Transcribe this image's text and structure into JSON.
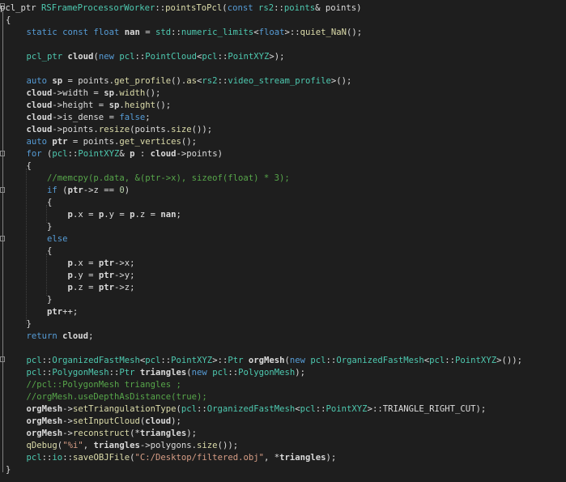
{
  "editor": {
    "theme_colors": {
      "background": "#1e1e1e",
      "plain": "#dcdcdc",
      "keyword": "#569cd6",
      "type": "#4ec9b0",
      "function": "#dcdcaa",
      "variable": "#dadada",
      "comment": "#57a64a",
      "string": "#d69d85",
      "number": "#b5cea8"
    },
    "lines": [
      [
        [
          "plain",
          "pcl_ptr "
        ],
        [
          "type",
          "RSFrameProcessorWorker"
        ],
        [
          "plain",
          "::"
        ],
        [
          "func",
          "pointsToPcl"
        ],
        [
          "plain",
          "("
        ],
        [
          "kw",
          "const "
        ],
        [
          "type",
          "rs2"
        ],
        [
          "plain",
          "::"
        ],
        [
          "type",
          "points"
        ],
        [
          "plain",
          "& points)"
        ]
      ],
      [
        [
          "plain",
          "{"
        ]
      ],
      [
        [
          "plain",
          "    "
        ],
        [
          "kw",
          "static const float "
        ],
        [
          "var",
          "nan"
        ],
        [
          "plain",
          " = "
        ],
        [
          "type",
          "std"
        ],
        [
          "plain",
          "::"
        ],
        [
          "type",
          "numeric_limits"
        ],
        [
          "plain",
          "<"
        ],
        [
          "kw",
          "float"
        ],
        [
          "plain",
          ">::"
        ],
        [
          "func",
          "quiet_NaN"
        ],
        [
          "plain",
          "();"
        ]
      ],
      [
        [
          "plain",
          ""
        ]
      ],
      [
        [
          "plain",
          "    "
        ],
        [
          "type",
          "pcl_ptr "
        ],
        [
          "var",
          "cloud"
        ],
        [
          "plain",
          "("
        ],
        [
          "kw",
          "new "
        ],
        [
          "type",
          "pcl"
        ],
        [
          "plain",
          "::"
        ],
        [
          "type",
          "PointCloud"
        ],
        [
          "plain",
          "<"
        ],
        [
          "type",
          "pcl"
        ],
        [
          "plain",
          "::"
        ],
        [
          "type",
          "PointXYZ"
        ],
        [
          "plain",
          ">);"
        ]
      ],
      [
        [
          "plain",
          ""
        ]
      ],
      [
        [
          "plain",
          "    "
        ],
        [
          "kw",
          "auto "
        ],
        [
          "var",
          "sp"
        ],
        [
          "plain",
          " = points."
        ],
        [
          "func",
          "get_profile"
        ],
        [
          "plain",
          "()."
        ],
        [
          "func",
          "as"
        ],
        [
          "plain",
          "<"
        ],
        [
          "type",
          "rs2"
        ],
        [
          "plain",
          "::"
        ],
        [
          "type",
          "video_stream_profile"
        ],
        [
          "plain",
          ">();"
        ]
      ],
      [
        [
          "plain",
          "    "
        ],
        [
          "var",
          "cloud"
        ],
        [
          "plain",
          "->width = "
        ],
        [
          "var",
          "sp"
        ],
        [
          "plain",
          "."
        ],
        [
          "func",
          "width"
        ],
        [
          "plain",
          "();"
        ]
      ],
      [
        [
          "plain",
          "    "
        ],
        [
          "var",
          "cloud"
        ],
        [
          "plain",
          "->height = "
        ],
        [
          "var",
          "sp"
        ],
        [
          "plain",
          "."
        ],
        [
          "func",
          "height"
        ],
        [
          "plain",
          "();"
        ]
      ],
      [
        [
          "plain",
          "    "
        ],
        [
          "var",
          "cloud"
        ],
        [
          "plain",
          "->is_dense = "
        ],
        [
          "kw",
          "false"
        ],
        [
          "plain",
          ";"
        ]
      ],
      [
        [
          "plain",
          "    "
        ],
        [
          "var",
          "cloud"
        ],
        [
          "plain",
          "->points."
        ],
        [
          "func",
          "resize"
        ],
        [
          "plain",
          "(points."
        ],
        [
          "func",
          "size"
        ],
        [
          "plain",
          "());"
        ]
      ],
      [
        [
          "plain",
          "    "
        ],
        [
          "kw",
          "auto "
        ],
        [
          "var",
          "ptr"
        ],
        [
          "plain",
          " = points."
        ],
        [
          "func",
          "get_vertices"
        ],
        [
          "plain",
          "();"
        ]
      ],
      [
        [
          "plain",
          "    "
        ],
        [
          "kw",
          "for "
        ],
        [
          "plain",
          "("
        ],
        [
          "type",
          "pcl"
        ],
        [
          "plain",
          "::"
        ],
        [
          "type",
          "PointXYZ"
        ],
        [
          "plain",
          "& "
        ],
        [
          "var",
          "p"
        ],
        [
          "plain",
          " : "
        ],
        [
          "var",
          "cloud"
        ],
        [
          "plain",
          "->points)"
        ]
      ],
      [
        [
          "plain",
          "    {"
        ]
      ],
      [
        [
          "plain",
          "        "
        ],
        [
          "cmt",
          "//memcpy(p.data, &(ptr->x), sizeof(float) * 3);"
        ]
      ],
      [
        [
          "plain",
          "        "
        ],
        [
          "kw",
          "if "
        ],
        [
          "plain",
          "("
        ],
        [
          "var",
          "ptr"
        ],
        [
          "plain",
          "->z == "
        ],
        [
          "num",
          "0"
        ],
        [
          "plain",
          ")"
        ]
      ],
      [
        [
          "plain",
          "        {"
        ]
      ],
      [
        [
          "plain",
          "            "
        ],
        [
          "var",
          "p"
        ],
        [
          "plain",
          ".x = "
        ],
        [
          "var",
          "p"
        ],
        [
          "plain",
          ".y = "
        ],
        [
          "var",
          "p"
        ],
        [
          "plain",
          ".z = "
        ],
        [
          "var",
          "nan"
        ],
        [
          "plain",
          ";"
        ]
      ],
      [
        [
          "plain",
          "        }"
        ]
      ],
      [
        [
          "plain",
          "        "
        ],
        [
          "kw",
          "else"
        ]
      ],
      [
        [
          "plain",
          "        {"
        ]
      ],
      [
        [
          "plain",
          "            "
        ],
        [
          "var",
          "p"
        ],
        [
          "plain",
          ".x = "
        ],
        [
          "var",
          "ptr"
        ],
        [
          "plain",
          "->x;"
        ]
      ],
      [
        [
          "plain",
          "            "
        ],
        [
          "var",
          "p"
        ],
        [
          "plain",
          ".y = "
        ],
        [
          "var",
          "ptr"
        ],
        [
          "plain",
          "->y;"
        ]
      ],
      [
        [
          "plain",
          "            "
        ],
        [
          "var",
          "p"
        ],
        [
          "plain",
          ".z = "
        ],
        [
          "var",
          "ptr"
        ],
        [
          "plain",
          "->z;"
        ]
      ],
      [
        [
          "plain",
          "        }"
        ]
      ],
      [
        [
          "plain",
          "        "
        ],
        [
          "var",
          "ptr"
        ],
        [
          "plain",
          "++;"
        ]
      ],
      [
        [
          "plain",
          "    }"
        ]
      ],
      [
        [
          "plain",
          "    "
        ],
        [
          "kw",
          "return "
        ],
        [
          "var",
          "cloud"
        ],
        [
          "plain",
          ";"
        ]
      ],
      [
        [
          "plain",
          ""
        ]
      ],
      [
        [
          "plain",
          "    "
        ],
        [
          "type",
          "pcl"
        ],
        [
          "plain",
          "::"
        ],
        [
          "type",
          "OrganizedFastMesh"
        ],
        [
          "plain",
          "<"
        ],
        [
          "type",
          "pcl"
        ],
        [
          "plain",
          "::"
        ],
        [
          "type",
          "PointXYZ"
        ],
        [
          "plain",
          ">::"
        ],
        [
          "type",
          "Ptr "
        ],
        [
          "var",
          "orgMesh"
        ],
        [
          "plain",
          "("
        ],
        [
          "kw",
          "new "
        ],
        [
          "type",
          "pcl"
        ],
        [
          "plain",
          "::"
        ],
        [
          "type",
          "OrganizedFastMesh"
        ],
        [
          "plain",
          "<"
        ],
        [
          "type",
          "pcl"
        ],
        [
          "plain",
          "::"
        ],
        [
          "type",
          "PointXYZ"
        ],
        [
          "plain",
          ">());"
        ]
      ],
      [
        [
          "plain",
          "    "
        ],
        [
          "type",
          "pcl"
        ],
        [
          "plain",
          "::"
        ],
        [
          "type",
          "PolygonMesh"
        ],
        [
          "plain",
          "::"
        ],
        [
          "type",
          "Ptr "
        ],
        [
          "var",
          "triangles"
        ],
        [
          "plain",
          "("
        ],
        [
          "kw",
          "new "
        ],
        [
          "type",
          "pcl"
        ],
        [
          "plain",
          "::"
        ],
        [
          "type",
          "PolygonMesh"
        ],
        [
          "plain",
          ");"
        ]
      ],
      [
        [
          "plain",
          "    "
        ],
        [
          "cmt",
          "//pcl::PolygonMesh triangles ;"
        ]
      ],
      [
        [
          "plain",
          "    "
        ],
        [
          "cmt",
          "//orgMesh.useDepthAsDistance(true);"
        ]
      ],
      [
        [
          "plain",
          "    "
        ],
        [
          "var",
          "orgMesh"
        ],
        [
          "plain",
          "->"
        ],
        [
          "func",
          "setTriangulationType"
        ],
        [
          "plain",
          "("
        ],
        [
          "type",
          "pcl"
        ],
        [
          "plain",
          "::"
        ],
        [
          "type",
          "OrganizedFastMesh"
        ],
        [
          "plain",
          "<"
        ],
        [
          "type",
          "pcl"
        ],
        [
          "plain",
          "::"
        ],
        [
          "type",
          "PointXYZ"
        ],
        [
          "plain",
          ">::TRIANGLE_RIGHT_CUT);"
        ]
      ],
      [
        [
          "plain",
          "    "
        ],
        [
          "var",
          "orgMesh"
        ],
        [
          "plain",
          "->"
        ],
        [
          "func",
          "setInputCloud"
        ],
        [
          "plain",
          "("
        ],
        [
          "var",
          "cloud"
        ],
        [
          "plain",
          ");"
        ]
      ],
      [
        [
          "plain",
          "    "
        ],
        [
          "var",
          "orgMesh"
        ],
        [
          "plain",
          "->"
        ],
        [
          "func",
          "reconstruct"
        ],
        [
          "plain",
          "(*"
        ],
        [
          "var",
          "triangles"
        ],
        [
          "plain",
          ");"
        ]
      ],
      [
        [
          "plain",
          "    "
        ],
        [
          "func",
          "qDebug"
        ],
        [
          "plain",
          "("
        ],
        [
          "str",
          "\"%i\""
        ],
        [
          "plain",
          ", "
        ],
        [
          "var",
          "triangles"
        ],
        [
          "plain",
          "->polygons."
        ],
        [
          "func",
          "size"
        ],
        [
          "plain",
          "());"
        ]
      ],
      [
        [
          "plain",
          "    "
        ],
        [
          "type",
          "pcl"
        ],
        [
          "plain",
          "::"
        ],
        [
          "type",
          "io"
        ],
        [
          "plain",
          "::"
        ],
        [
          "func",
          "saveOBJFile"
        ],
        [
          "plain",
          "("
        ],
        [
          "str",
          "\"C:/Desktop/filtered.obj\""
        ],
        [
          "plain",
          ", *"
        ],
        [
          "var",
          "triangles"
        ],
        [
          "plain",
          ");"
        ]
      ],
      [
        [
          "plain",
          "}"
        ]
      ]
    ]
  }
}
